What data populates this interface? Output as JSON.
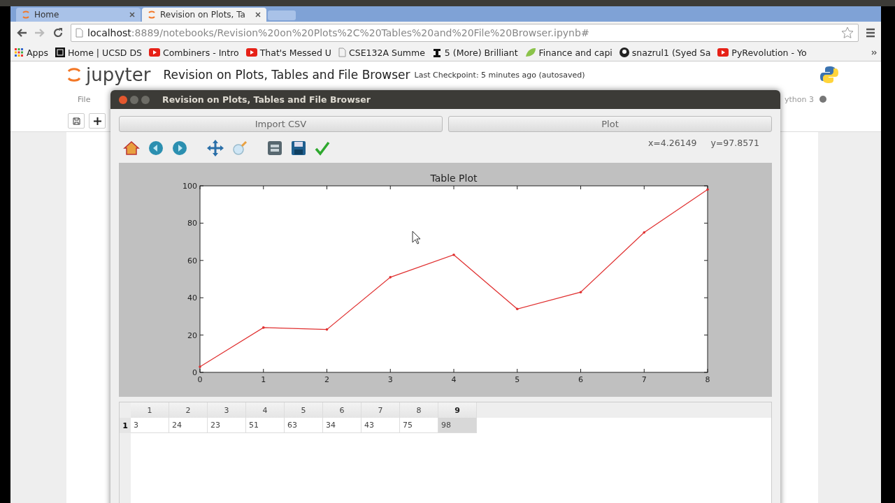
{
  "browser": {
    "tabs": [
      {
        "label": "Home",
        "selected": false
      },
      {
        "label": "Revision on Plots, Ta",
        "selected": true
      }
    ],
    "url": {
      "host": "localhost",
      "path": ":8889/notebooks/Revision%20on%20Plots%2C%20Tables%20and%20File%20Browser.ipynb#"
    },
    "bookmarks": [
      "Apps",
      "Home | UCSD DS",
      "Combiners - Intro",
      "That's Messed U",
      "CSE132A Summe",
      "5 (More) Brilliant",
      "Finance and capi",
      "snazrul1 (Syed Sa",
      "PyRevolution - Yo"
    ]
  },
  "notebook": {
    "logo": "jupyter",
    "title": "Revision on Plots, Tables and File Browser",
    "checkpoint": "Last Checkpoint: 5 minutes ago (autosaved)",
    "menu": [
      "File"
    ],
    "kernel": "ython 3"
  },
  "dialog": {
    "title": "Revision on Plots, Tables and File Browser",
    "buttons": [
      "Import CSV",
      "Plot"
    ],
    "coords": [
      "x=4.26149",
      "y=97.8571"
    ],
    "chart_data": {
      "type": "line",
      "title": "Table Plot",
      "x": [
        0,
        1,
        2,
        3,
        4,
        5,
        6,
        7,
        8
      ],
      "series": [
        {
          "color": "#e03030",
          "values": [
            3,
            24,
            23,
            51,
            63,
            34,
            43,
            75,
            98
          ]
        }
      ],
      "xlim": [
        0,
        8
      ],
      "ylim": [
        0,
        100
      ],
      "xticks": [
        0,
        1,
        2,
        3,
        4,
        5,
        6,
        7,
        8
      ],
      "yticks": [
        0,
        20,
        40,
        60,
        80,
        100
      ]
    },
    "table": {
      "columns": [
        "1",
        "2",
        "3",
        "4",
        "5",
        "6",
        "7",
        "8",
        "9"
      ],
      "rows": [
        {
          "header": "1",
          "cells": [
            {
              "value": "3",
              "selected": false
            },
            {
              "value": "24",
              "selected": false
            },
            {
              "value": "23",
              "selected": false
            },
            {
              "value": "51",
              "selected": false
            },
            {
              "value": "63",
              "selected": false
            },
            {
              "value": "34",
              "selected": false
            },
            {
              "value": "43",
              "selected": false
            },
            {
              "value": "75",
              "selected": false
            },
            {
              "value": "98",
              "selected": true
            }
          ]
        }
      ]
    }
  }
}
